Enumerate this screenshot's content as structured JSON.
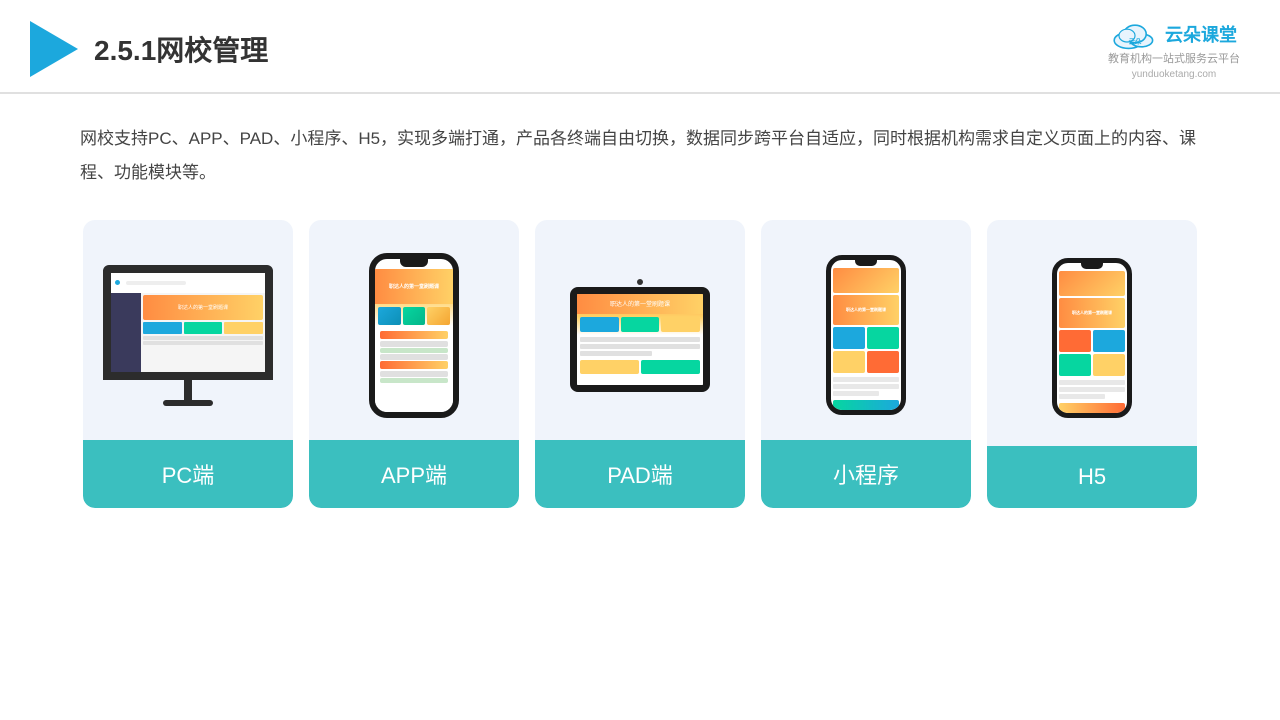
{
  "header": {
    "title": "2.5.1网校管理",
    "brand_name": "云朵课堂",
    "brand_subtitle_line1": "教育机构一站",
    "brand_subtitle_line2": "式服务云平台",
    "brand_url": "yunduoketang.com"
  },
  "description": {
    "text": "网校支持PC、APP、PAD、小程序、H5，实现多端打通，产品各终端自由切换，数据同步跨平台自适应，同时根据机构需求自定义页面上的内容、课程、功能模块等。"
  },
  "cards": [
    {
      "id": "pc",
      "label": "PC端"
    },
    {
      "id": "app",
      "label": "APP端"
    },
    {
      "id": "pad",
      "label": "PAD端"
    },
    {
      "id": "miniapp",
      "label": "小程序"
    },
    {
      "id": "h5",
      "label": "H5"
    }
  ],
  "colors": {
    "teal": "#3bbfbf",
    "blue": "#1ca8dd",
    "bg_card": "#eef2f8"
  }
}
